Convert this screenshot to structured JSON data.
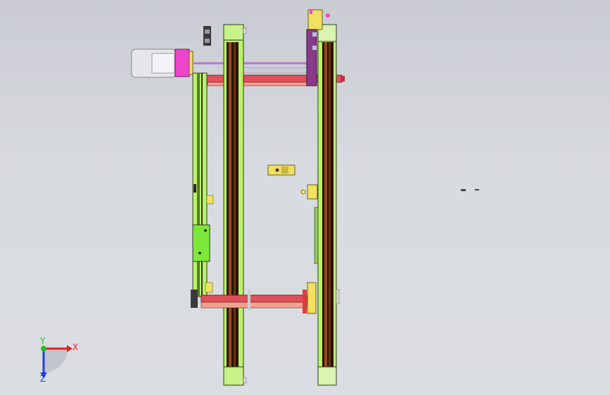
{
  "viewport": {
    "background_top": "#c9ccd2",
    "background_bottom": "#dadde1"
  },
  "triad": {
    "x_label": "X",
    "y_label": "Y",
    "z_label": "Z",
    "x_color": "#e02020",
    "y_color": "#20c020",
    "z_color": "#2040e0"
  },
  "colors": {
    "frame_green": "#b9f26a",
    "frame_dark": "#2f3a1e",
    "belt_dark": "#3a1e0c",
    "belt_brown": "#8a4a1a",
    "rod_red": "#e0505a",
    "rod_pink": "#f07a8a",
    "motor_gray": "#e4e4ea",
    "motor_magenta": "#ee44cc",
    "bracket_yellow": "#f2e060",
    "plate_green": "#7ee83a",
    "purple": "#8a3a8a"
  }
}
